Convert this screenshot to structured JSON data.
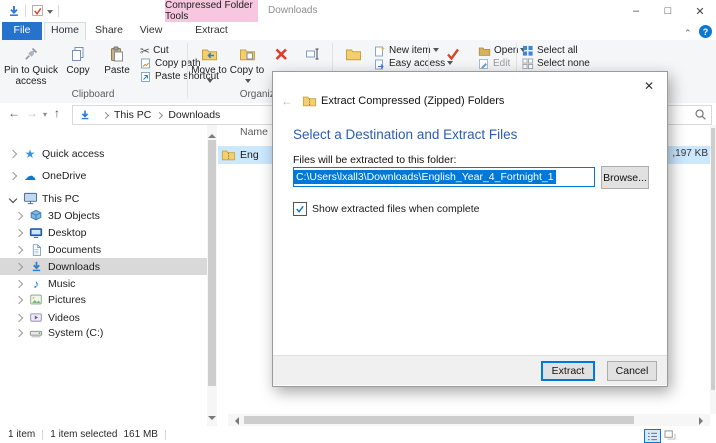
{
  "titlebar": {
    "contextual_tab_group": "Compressed Folder Tools",
    "window_title": "Downloads"
  },
  "tabs": {
    "file": "File",
    "home": "Home",
    "share": "Share",
    "view": "View",
    "extract": "Extract"
  },
  "ribbon": {
    "clipboard": {
      "group_label": "Clipboard",
      "pin": "Pin to Quick access",
      "copy": "Copy",
      "paste": "Paste",
      "cut": "Cut",
      "copy_path": "Copy path",
      "paste_shortcut": "Paste shortcut"
    },
    "organize": {
      "group_label": "Organize",
      "move_to": "Move to",
      "copy_to": "Copy to"
    },
    "new_group": {
      "new_item": "New item",
      "easy_access": "Easy access"
    },
    "open_group": {
      "open": "Open",
      "edit": "Edit"
    },
    "select_group": {
      "select_all": "Select all",
      "select_none": "Select none"
    }
  },
  "address": {
    "crumbs": [
      "This PC",
      "Downloads"
    ]
  },
  "sidebar": {
    "items": [
      {
        "label": "Quick access",
        "icon": "star",
        "level": 0,
        "expanded": false
      },
      {
        "label": "OneDrive",
        "icon": "cloud",
        "level": 0,
        "expanded": false
      },
      {
        "label": "This PC",
        "icon": "computer",
        "level": 0,
        "expanded": true
      },
      {
        "label": "3D Objects",
        "icon": "cube",
        "level": 1
      },
      {
        "label": "Desktop",
        "icon": "monitor",
        "level": 1
      },
      {
        "label": "Documents",
        "icon": "document",
        "level": 1
      },
      {
        "label": "Downloads",
        "icon": "download-arrow",
        "level": 1,
        "selected": true
      },
      {
        "label": "Music",
        "icon": "music-note",
        "level": 1
      },
      {
        "label": "Pictures",
        "icon": "picture",
        "level": 1
      },
      {
        "label": "Videos",
        "icon": "video",
        "level": 1
      },
      {
        "label": "System (C:)",
        "icon": "drive",
        "level": 1
      }
    ]
  },
  "file_list": {
    "name_column_header": "Name",
    "selected_row": {
      "name_visible": "Eng",
      "size_visible": ",197 KB"
    }
  },
  "dialog": {
    "title": "Extract Compressed (Zipped) Folders",
    "heading": "Select a Destination and Extract Files",
    "field_label": "Files will be extracted to this folder:",
    "destination_path": "C:\\Users\\lxall3\\Downloads\\English_Year_4_Fortnight_1",
    "browse_button": "Browse...",
    "checkbox_label": "Show extracted files when complete",
    "checkbox_checked": true,
    "extract_button": "Extract",
    "cancel_button": "Cancel"
  },
  "status_bar": {
    "item_count": "1 item",
    "selected_count": "1 item selected",
    "selected_size": "161 MB"
  },
  "colors": {
    "accent_blue": "#0078d7",
    "context_tab_pink": "#f6c7de",
    "file_tab_blue": "#2573cd",
    "heading_blue": "#2b5db4",
    "selection_fill": "#cce8ff",
    "inactive_selection": "#d9d9d9"
  }
}
